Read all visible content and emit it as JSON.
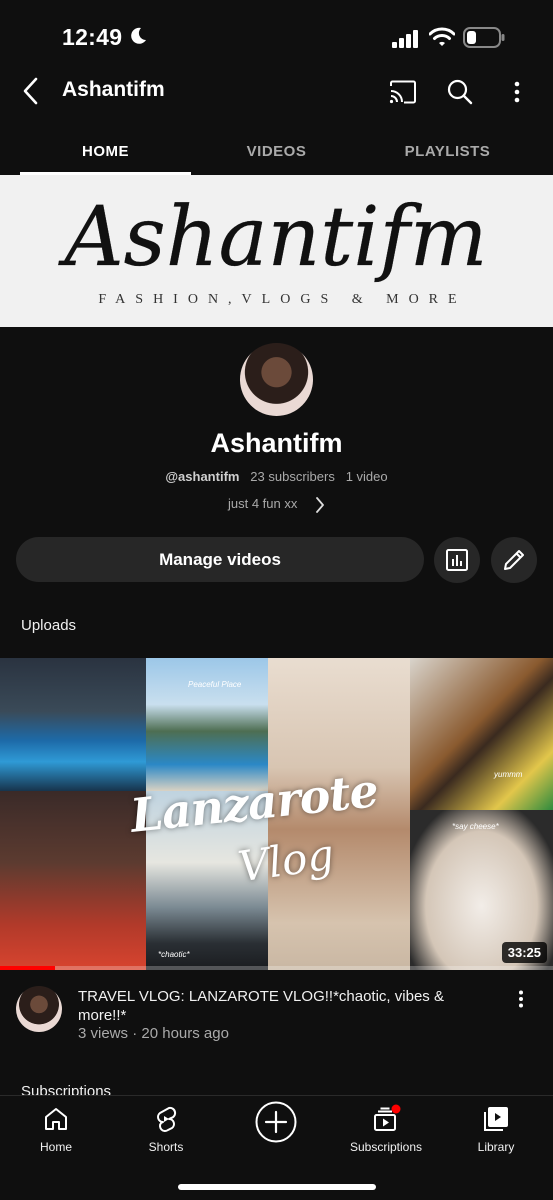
{
  "status_bar": {
    "time": "12:49"
  },
  "header": {
    "title": "Ashantifm"
  },
  "tabs": [
    {
      "label": "HOME"
    },
    {
      "label": "VIDEOS"
    },
    {
      "label": "PLAYLISTS"
    }
  ],
  "banner": {
    "script_text": "Ashantifm",
    "tagline": "FASHION,VLOGS & MORE"
  },
  "channel": {
    "name": "Ashantifm",
    "handle": "@ashantifm",
    "subscribers": "23 subscribers",
    "videos": "1 video",
    "description": "just 4 fun xx"
  },
  "actions": {
    "manage_label": "Manage videos"
  },
  "uploads": {
    "section_label": "Uploads",
    "video": {
      "thumb_title_1": "Lanzarote",
      "thumb_title_2": "Vlog",
      "thumb_caption_1": "Peaceful Place",
      "thumb_caption_2": "*chaotic*",
      "thumb_caption_3": "yummm",
      "thumb_caption_4": "*say cheese*",
      "duration": "33:25",
      "progress": 0.1,
      "title": "TRAVEL VLOG: LANZAROTE VLOG!!*chaotic, vibes & more!!*",
      "views": "3 views",
      "age": "20 hours ago"
    }
  },
  "next_section_label": "Subscriptions",
  "bottom_nav": [
    {
      "label": "Home",
      "icon": "home-icon"
    },
    {
      "label": "Shorts",
      "icon": "shorts-icon"
    },
    {
      "label": "",
      "icon": "create-icon"
    },
    {
      "label": "Subscriptions",
      "icon": "subscriptions-icon"
    },
    {
      "label": "Library",
      "icon": "library-icon"
    }
  ],
  "colors": {
    "background": "#0f0f0f",
    "surface": "#272727",
    "accent": "#ff0000",
    "banner": "#f1f1f1"
  }
}
